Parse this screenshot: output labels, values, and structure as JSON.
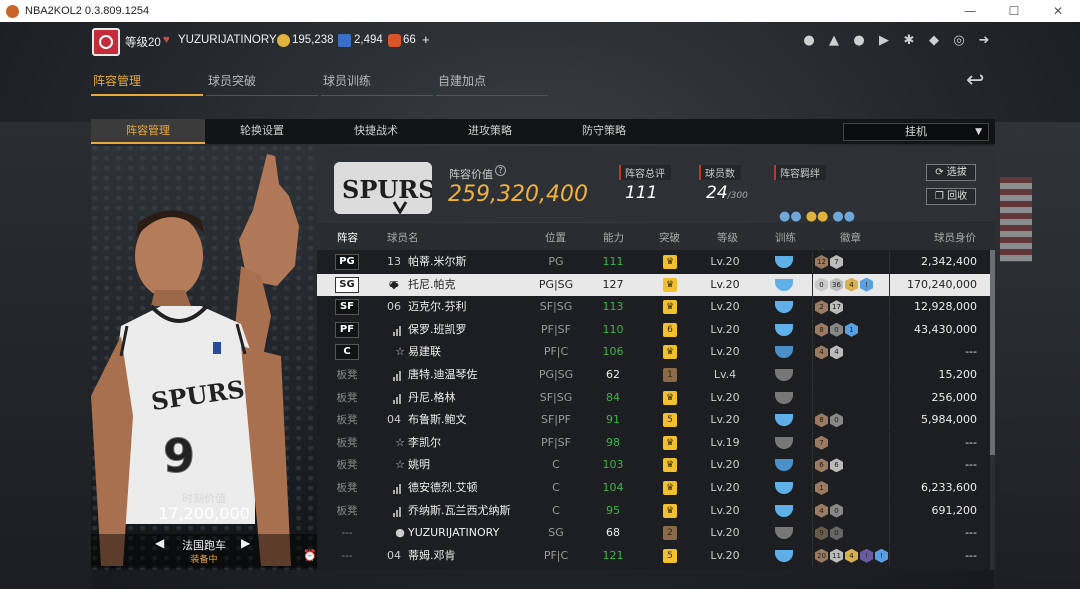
{
  "window": {
    "title": "NBA2KOL2 0.3.809.1254",
    "minimize": "—",
    "maximize": "☐",
    "close": "✕"
  },
  "header": {
    "level": "等级20",
    "username": "YUZURIJATINORY",
    "gold": "195,238",
    "points": "2,494",
    "coupons": "66",
    "plus": "+"
  },
  "top_tabs": [
    "阵容管理",
    "球员突破",
    "球员训练",
    "自建加点"
  ],
  "sub_tabs": [
    "阵容管理",
    "轮换设置",
    "快捷战术",
    "进攻策略",
    "防守策略"
  ],
  "dropdown": {
    "value": "挂机"
  },
  "card": {
    "jersey_text": "SPURS",
    "jersey_number": "9",
    "value_label": "时刻价值",
    "value": "17,200,000",
    "car_name": "法国跑车",
    "car_status": "装备中"
  },
  "info": {
    "logo_text": "SPURS",
    "lineup_value_label": "阵容价值",
    "lineup_value": "259,320,400",
    "rating_label": "阵容总评",
    "rating": "111",
    "count_label": "球员数",
    "count": "24",
    "count_max": "/300",
    "bond_label": "阵容羁绊",
    "btn_select": "选拔",
    "btn_recycle": "回收"
  },
  "columns": [
    "阵容",
    "球员名",
    "位置",
    "能力",
    "突破",
    "等级",
    "训练",
    "徽章",
    "球员身价"
  ],
  "rows": [
    {
      "slot": "PG",
      "num": "13",
      "name": "帕蒂.米尔斯",
      "pos": "PG",
      "ability": "111",
      "ac": "#3db34a",
      "lv": "Lv.20",
      "worth": "2,342,400",
      "badges": [
        "12",
        "7"
      ],
      "bc": [
        "#9a7a60",
        "#bbbbbb"
      ],
      "brk": "♛",
      "brkc": "#f0c030",
      "tr": "#5fb0e8",
      "ic": "num"
    },
    {
      "slot": "SG",
      "num": "05",
      "name": "托尼.帕克",
      "pos": "PG|SG",
      "ability": "127",
      "ac": "#222",
      "lv": "Lv.20",
      "worth": "170,240,000",
      "badges": [
        "0",
        "36",
        "4",
        "!"
      ],
      "bc": [
        "#c9c9c9",
        "#bdbdbd",
        "#d8b050",
        "#5aa0e0"
      ],
      "brk": "♛",
      "brkc": "#f0c030",
      "tr": "#5fb0e8",
      "ic": "dia",
      "hl": true
    },
    {
      "slot": "SF",
      "num": "06",
      "name": "迈克尔.芬利",
      "pos": "SF|SG",
      "ability": "113",
      "ac": "#3db34a",
      "lv": "Lv.20",
      "worth": "12,928,000",
      "badges": [
        "2",
        "17"
      ],
      "bc": [
        "#9a7a60",
        "#bbbbbb"
      ],
      "brk": "♛",
      "brkc": "#f0c030",
      "tr": "#5fb0e8",
      "ic": "num"
    },
    {
      "slot": "PF",
      "num": "",
      "name": "保罗.班凯罗",
      "pos": "PF|SF",
      "ability": "110",
      "ac": "#3db34a",
      "lv": "Lv.20",
      "worth": "43,430,000",
      "badges": [
        "8",
        "0",
        "1"
      ],
      "bc": [
        "#9a7a60",
        "#888888",
        "#5aa0e0"
      ],
      "brk": "6",
      "brkc": "#f0c030",
      "tr": "#5fb0e8",
      "ic": "bars"
    },
    {
      "slot": "C",
      "num": "",
      "name": "易建联",
      "pos": "PF|C",
      "ability": "106",
      "ac": "#3db34a",
      "lv": "Lv.20",
      "worth": "---",
      "badges": [
        "4",
        "4"
      ],
      "bc": [
        "#9a7a60",
        "#bbbbbb"
      ],
      "brk": "♛",
      "brkc": "#f0c030",
      "tr": "#4a90c8",
      "ic": "star"
    },
    {
      "slot": "板凳",
      "num": "",
      "name": "唐特.迪温琴佐",
      "pos": "PG|SG",
      "ability": "62",
      "ac": "#eeeeee",
      "lv": "Lv.4",
      "worth": "15,200",
      "badges": [],
      "bc": [],
      "brk": "1",
      "brkc": "#8a6a4a",
      "tr": "#777777",
      "ic": "bars"
    },
    {
      "slot": "板凳",
      "num": "",
      "name": "丹尼.格林",
      "pos": "SF|SG",
      "ability": "84",
      "ac": "#3db34a",
      "lv": "Lv.20",
      "worth": "256,000",
      "badges": [],
      "bc": [],
      "brk": "♛",
      "brkc": "#f0c030",
      "tr": "#777777",
      "ic": "bars"
    },
    {
      "slot": "板凳",
      "num": "04",
      "name": "布鲁斯.鲍文",
      "pos": "SF|PF",
      "ability": "91",
      "ac": "#3db34a",
      "lv": "Lv.20",
      "worth": "5,984,000",
      "badges": [
        "8",
        "0"
      ],
      "bc": [
        "#9a7a60",
        "#888888"
      ],
      "brk": "5",
      "brkc": "#f0c030",
      "tr": "#5fb0e8",
      "ic": "num"
    },
    {
      "slot": "板凳",
      "num": "",
      "name": "李凯尔",
      "pos": "PF|SF",
      "ability": "98",
      "ac": "#3db34a",
      "lv": "Lv.19",
      "worth": "---",
      "badges": [
        "7"
      ],
      "bc": [
        "#9a7a60"
      ],
      "brk": "♛",
      "brkc": "#f0c030",
      "tr": "#777777",
      "ic": "star"
    },
    {
      "slot": "板凳",
      "num": "",
      "name": "姚明",
      "pos": "C",
      "ability": "103",
      "ac": "#3db34a",
      "lv": "Lv.20",
      "worth": "---",
      "badges": [
        "6",
        "6"
      ],
      "bc": [
        "#9a7a60",
        "#bbbbbb"
      ],
      "brk": "♛",
      "brkc": "#f0c030",
      "tr": "#4a90c8",
      "ic": "star"
    },
    {
      "slot": "板凳",
      "num": "",
      "name": "德安德烈.艾顿",
      "pos": "C",
      "ability": "104",
      "ac": "#3db34a",
      "lv": "Lv.20",
      "worth": "6,233,600",
      "badges": [
        "1"
      ],
      "bc": [
        "#9a7a60"
      ],
      "brk": "♛",
      "brkc": "#f0c030",
      "tr": "#5fb0e8",
      "ic": "bars"
    },
    {
      "slot": "板凳",
      "num": "",
      "name": "乔纳斯.瓦兰西尤纳斯",
      "pos": "C",
      "ability": "95",
      "ac": "#3db34a",
      "lv": "Lv.20",
      "worth": "691,200",
      "badges": [
        "4",
        "0"
      ],
      "bc": [
        "#9a7a60",
        "#888888"
      ],
      "brk": "♛",
      "brkc": "#f0c030",
      "tr": "#5fb0e8",
      "ic": "bars"
    },
    {
      "slot": "---",
      "num": "",
      "name": "YUZURIJATINORY",
      "pos": "SG",
      "ability": "68",
      "ac": "#eeeeee",
      "lv": "Lv.20",
      "worth": "---",
      "badges": [
        "9",
        "0"
      ],
      "bc": [
        "#6a5a4a",
        "#666666"
      ],
      "brk": "2",
      "brkc": "#8a6a4a",
      "tr": "#777777",
      "ic": "user"
    },
    {
      "slot": "---",
      "num": "04",
      "name": "蒂姆.邓肯",
      "pos": "PF|C",
      "ability": "121",
      "ac": "#3db34a",
      "lv": "Lv.20",
      "worth": "---",
      "badges": [
        "20",
        "11",
        "4",
        "!",
        "!"
      ],
      "bc": [
        "#9a7a60",
        "#bbbbbb",
        "#d8b050",
        "#6a5aa0",
        "#5aa0e0"
      ],
      "brk": "5",
      "brkc": "#f0c030",
      "tr": "#5fb0e8",
      "ic": "num",
      "lock": true
    }
  ]
}
